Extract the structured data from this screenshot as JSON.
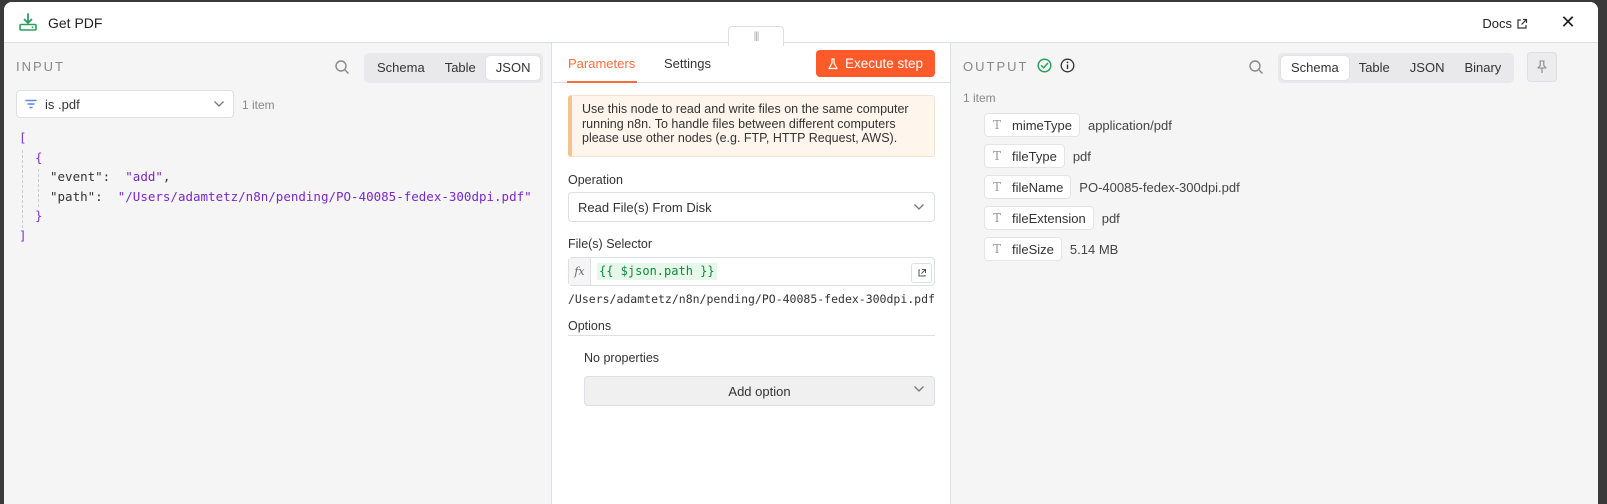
{
  "header": {
    "title": "Get PDF",
    "docs_label": "Docs",
    "close_glyph": "✕"
  },
  "input": {
    "label": "INPUT",
    "views": [
      "Schema",
      "Table",
      "JSON"
    ],
    "active_view": "JSON",
    "filter_value": "is .pdf",
    "item_count": "1 item",
    "json": {
      "open_bracket": "[",
      "open_brace": "{",
      "event_key": "\"event\":",
      "event_val": "\"add\"",
      "comma": ",",
      "path_key": "\"path\":",
      "path_val": "\"/Users/adamtetz/n8n/pending/PO-40085-fedex-300dpi.pdf\"",
      "close_brace": "}",
      "close_bracket": "]"
    }
  },
  "params": {
    "tabs": [
      "Parameters",
      "Settings"
    ],
    "active_tab": "Parameters",
    "execute_label": "Execute step",
    "notice": "Use this node to read and write files on the same computer running n8n. To handle files between different computers please use other nodes (e.g. FTP, HTTP Request, AWS).",
    "operation_label": "Operation",
    "operation_value": "Read File(s) From Disk",
    "selector_label": "File(s) Selector",
    "selector_fx": "fx",
    "selector_expression": "{{ $json.path }}",
    "selector_resolved": "/Users/adamtetz/n8n/pending/PO-40085-fedex-300dpi.pdf",
    "options_label": "Options",
    "no_properties": "No properties",
    "add_option_label": "Add option"
  },
  "output": {
    "label": "OUTPUT",
    "views": [
      "Schema",
      "Table",
      "JSON",
      "Binary"
    ],
    "active_view": "Schema",
    "item_count": "1 item",
    "fields": [
      {
        "name": "mimeType",
        "value": "application/pdf"
      },
      {
        "name": "fileType",
        "value": "pdf"
      },
      {
        "name": "fileName",
        "value": "PO-40085-fedex-300dpi.pdf"
      },
      {
        "name": "fileExtension",
        "value": "pdf"
      },
      {
        "name": "fileSize",
        "value": "5.14 MB"
      }
    ],
    "type_glyph": "T"
  },
  "colors": {
    "accent": "#ff6d3a",
    "execute_bg": "#ff5a2a",
    "success": "#29a35a",
    "json_string": "#7a28c9",
    "expression_green": "#0f8a3b",
    "node_icon": "#2f9e63"
  },
  "icons": [
    "node-download-icon",
    "external-link-icon",
    "close-icon",
    "search-icon",
    "filter-icon",
    "chevron-down-icon",
    "flask-icon",
    "expand-icon",
    "success-check-icon",
    "info-icon",
    "pin-icon",
    "type-text-icon"
  ]
}
